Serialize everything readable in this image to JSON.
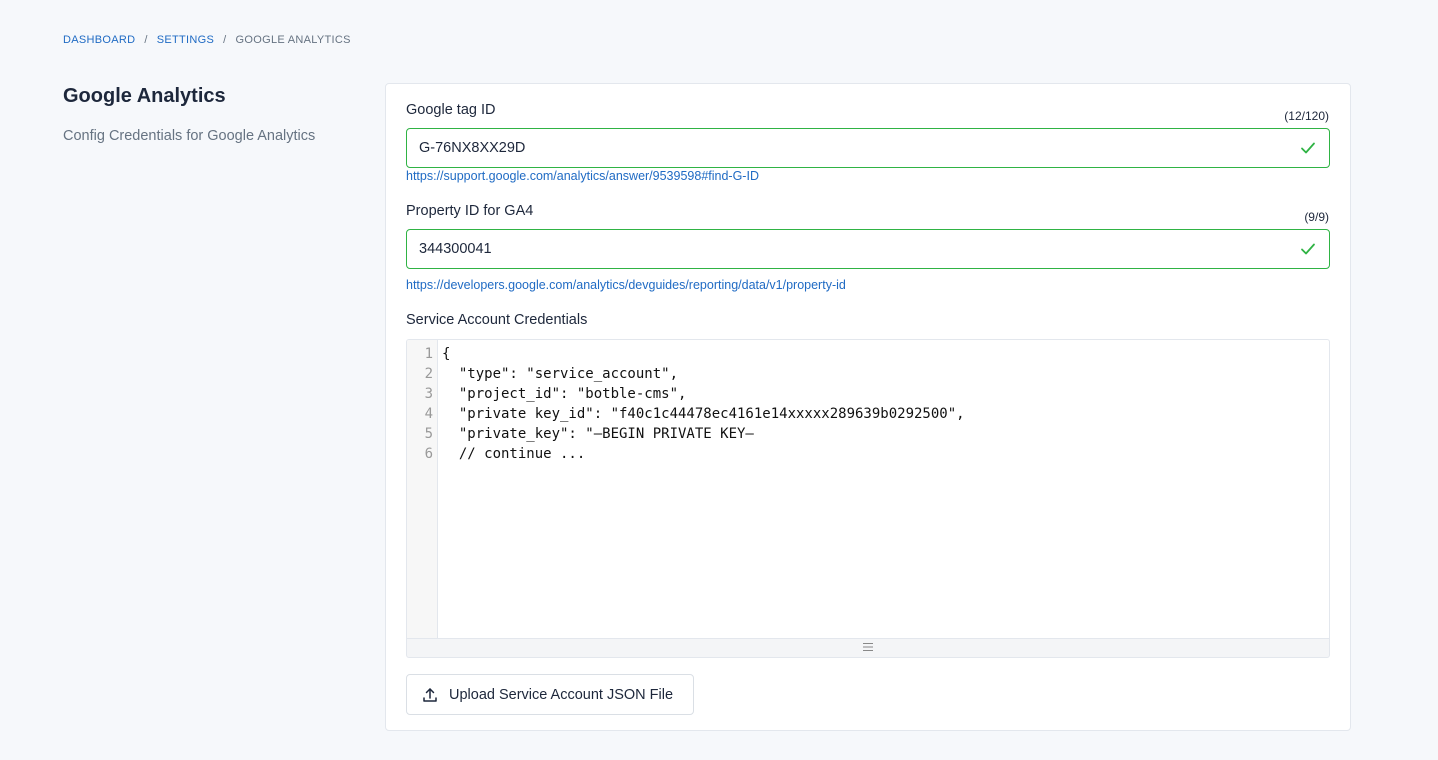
{
  "breadcrumb": {
    "items": [
      "DASHBOARD",
      "SETTINGS"
    ],
    "separator": "/",
    "current": "GOOGLE ANALYTICS"
  },
  "section": {
    "title": "Google Analytics",
    "description": "Config Credentials for Google Analytics"
  },
  "fields": {
    "tag_id": {
      "label": "Google tag ID",
      "counter": "(12/120)",
      "value": "G-76NX8XX29D",
      "help_link": "https://support.google.com/analytics/answer/9539598#find-G-ID"
    },
    "property_id": {
      "label": "Property ID for GA4",
      "counter": "(9/9)",
      "value": "344300041",
      "help_link": "https://developers.google.com/analytics/devguides/reporting/data/v1/property-id"
    },
    "credentials": {
      "label": "Service Account Credentials",
      "line_numbers": [
        "1",
        "2",
        "3",
        "4",
        "5",
        "6"
      ],
      "lines": [
        "{",
        "  \"type\": \"service_account\",",
        "  \"project_id\": \"botble-cms\",",
        "  \"private key_id\": \"f40c1c44478ec4161e14xxxxx289639b0292500\",",
        "  \"private_key\": \"—BEGIN PRIVATE KEY—",
        "  // continue ..."
      ]
    }
  },
  "upload_button": {
    "label": "Upload Service Account JSON File",
    "icon": "upload-icon"
  },
  "colors": {
    "link": "#206bc4",
    "valid": "#2fb344",
    "muted": "#667382"
  }
}
